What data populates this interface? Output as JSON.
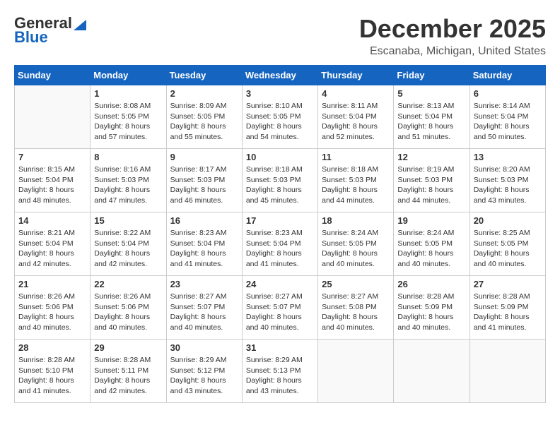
{
  "header": {
    "logo_general": "General",
    "logo_blue": "Blue",
    "month_title": "December 2025",
    "location": "Escanaba, Michigan, United States"
  },
  "days_of_week": [
    "Sunday",
    "Monday",
    "Tuesday",
    "Wednesday",
    "Thursday",
    "Friday",
    "Saturday"
  ],
  "weeks": [
    [
      {
        "day": "",
        "info": ""
      },
      {
        "day": "1",
        "info": "Sunrise: 8:08 AM\nSunset: 5:05 PM\nDaylight: 8 hours\nand 57 minutes."
      },
      {
        "day": "2",
        "info": "Sunrise: 8:09 AM\nSunset: 5:05 PM\nDaylight: 8 hours\nand 55 minutes."
      },
      {
        "day": "3",
        "info": "Sunrise: 8:10 AM\nSunset: 5:05 PM\nDaylight: 8 hours\nand 54 minutes."
      },
      {
        "day": "4",
        "info": "Sunrise: 8:11 AM\nSunset: 5:04 PM\nDaylight: 8 hours\nand 52 minutes."
      },
      {
        "day": "5",
        "info": "Sunrise: 8:13 AM\nSunset: 5:04 PM\nDaylight: 8 hours\nand 51 minutes."
      },
      {
        "day": "6",
        "info": "Sunrise: 8:14 AM\nSunset: 5:04 PM\nDaylight: 8 hours\nand 50 minutes."
      }
    ],
    [
      {
        "day": "7",
        "info": "Sunrise: 8:15 AM\nSunset: 5:04 PM\nDaylight: 8 hours\nand 48 minutes."
      },
      {
        "day": "8",
        "info": "Sunrise: 8:16 AM\nSunset: 5:03 PM\nDaylight: 8 hours\nand 47 minutes."
      },
      {
        "day": "9",
        "info": "Sunrise: 8:17 AM\nSunset: 5:03 PM\nDaylight: 8 hours\nand 46 minutes."
      },
      {
        "day": "10",
        "info": "Sunrise: 8:18 AM\nSunset: 5:03 PM\nDaylight: 8 hours\nand 45 minutes."
      },
      {
        "day": "11",
        "info": "Sunrise: 8:18 AM\nSunset: 5:03 PM\nDaylight: 8 hours\nand 44 minutes."
      },
      {
        "day": "12",
        "info": "Sunrise: 8:19 AM\nSunset: 5:03 PM\nDaylight: 8 hours\nand 44 minutes."
      },
      {
        "day": "13",
        "info": "Sunrise: 8:20 AM\nSunset: 5:03 PM\nDaylight: 8 hours\nand 43 minutes."
      }
    ],
    [
      {
        "day": "14",
        "info": "Sunrise: 8:21 AM\nSunset: 5:04 PM\nDaylight: 8 hours\nand 42 minutes."
      },
      {
        "day": "15",
        "info": "Sunrise: 8:22 AM\nSunset: 5:04 PM\nDaylight: 8 hours\nand 42 minutes."
      },
      {
        "day": "16",
        "info": "Sunrise: 8:23 AM\nSunset: 5:04 PM\nDaylight: 8 hours\nand 41 minutes."
      },
      {
        "day": "17",
        "info": "Sunrise: 8:23 AM\nSunset: 5:04 PM\nDaylight: 8 hours\nand 41 minutes."
      },
      {
        "day": "18",
        "info": "Sunrise: 8:24 AM\nSunset: 5:05 PM\nDaylight: 8 hours\nand 40 minutes."
      },
      {
        "day": "19",
        "info": "Sunrise: 8:24 AM\nSunset: 5:05 PM\nDaylight: 8 hours\nand 40 minutes."
      },
      {
        "day": "20",
        "info": "Sunrise: 8:25 AM\nSunset: 5:05 PM\nDaylight: 8 hours\nand 40 minutes."
      }
    ],
    [
      {
        "day": "21",
        "info": "Sunrise: 8:26 AM\nSunset: 5:06 PM\nDaylight: 8 hours\nand 40 minutes."
      },
      {
        "day": "22",
        "info": "Sunrise: 8:26 AM\nSunset: 5:06 PM\nDaylight: 8 hours\nand 40 minutes."
      },
      {
        "day": "23",
        "info": "Sunrise: 8:27 AM\nSunset: 5:07 PM\nDaylight: 8 hours\nand 40 minutes."
      },
      {
        "day": "24",
        "info": "Sunrise: 8:27 AM\nSunset: 5:07 PM\nDaylight: 8 hours\nand 40 minutes."
      },
      {
        "day": "25",
        "info": "Sunrise: 8:27 AM\nSunset: 5:08 PM\nDaylight: 8 hours\nand 40 minutes."
      },
      {
        "day": "26",
        "info": "Sunrise: 8:28 AM\nSunset: 5:09 PM\nDaylight: 8 hours\nand 40 minutes."
      },
      {
        "day": "27",
        "info": "Sunrise: 8:28 AM\nSunset: 5:09 PM\nDaylight: 8 hours\nand 41 minutes."
      }
    ],
    [
      {
        "day": "28",
        "info": "Sunrise: 8:28 AM\nSunset: 5:10 PM\nDaylight: 8 hours\nand 41 minutes."
      },
      {
        "day": "29",
        "info": "Sunrise: 8:28 AM\nSunset: 5:11 PM\nDaylight: 8 hours\nand 42 minutes."
      },
      {
        "day": "30",
        "info": "Sunrise: 8:29 AM\nSunset: 5:12 PM\nDaylight: 8 hours\nand 43 minutes."
      },
      {
        "day": "31",
        "info": "Sunrise: 8:29 AM\nSunset: 5:13 PM\nDaylight: 8 hours\nand 43 minutes."
      },
      {
        "day": "",
        "info": ""
      },
      {
        "day": "",
        "info": ""
      },
      {
        "day": "",
        "info": ""
      }
    ]
  ]
}
